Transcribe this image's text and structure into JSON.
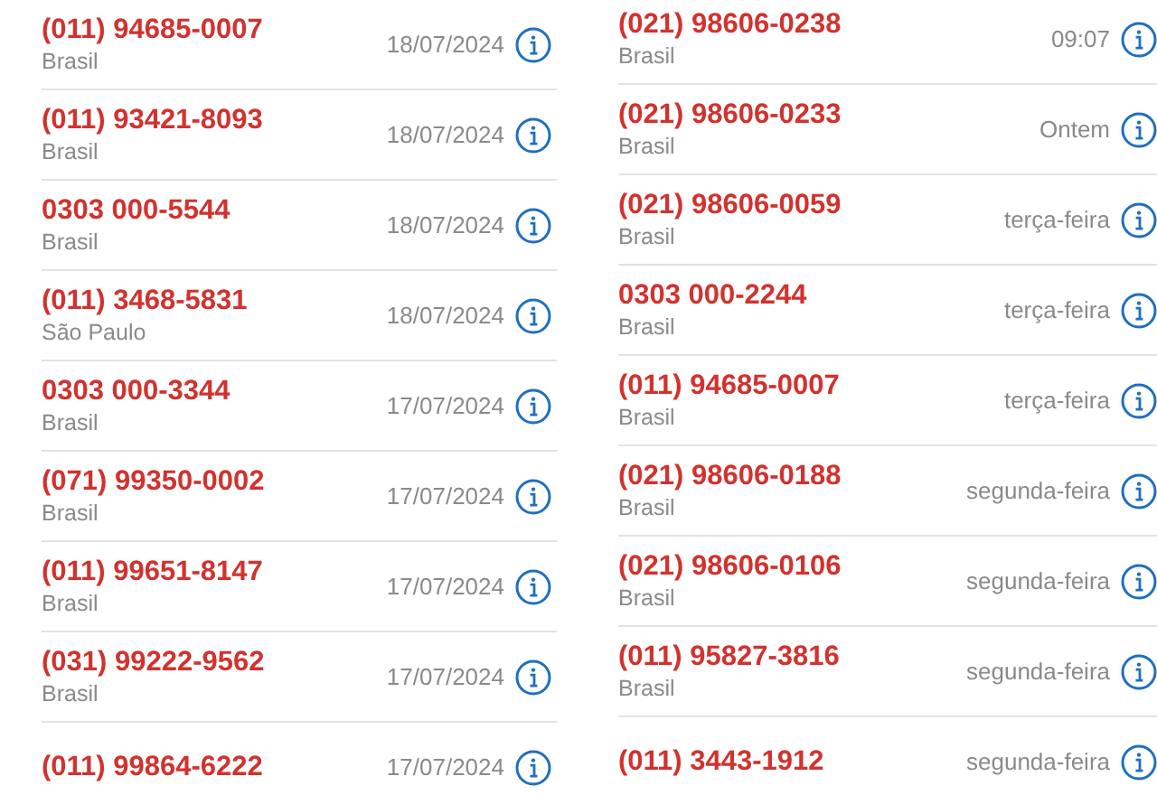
{
  "columns": [
    {
      "calls": [
        {
          "number": "(011) 94685-0007",
          "location": "Brasil",
          "time": "18/07/2024"
        },
        {
          "number": "(011) 93421-8093",
          "location": "Brasil",
          "time": "18/07/2024"
        },
        {
          "number": "0303 000-5544",
          "location": "Brasil",
          "time": "18/07/2024"
        },
        {
          "number": "(011) 3468-5831",
          "location": "São Paulo",
          "time": "18/07/2024"
        },
        {
          "number": "0303 000-3344",
          "location": "Brasil",
          "time": "17/07/2024"
        },
        {
          "number": "(071) 99350-0002",
          "location": "Brasil",
          "time": "17/07/2024"
        },
        {
          "number": "(011) 99651-8147",
          "location": "Brasil",
          "time": "17/07/2024"
        },
        {
          "number": "(031) 99222-9562",
          "location": "Brasil",
          "time": "17/07/2024"
        },
        {
          "number": "(011) 99864-6222",
          "time": "17/07/2024"
        }
      ]
    },
    {
      "calls": [
        {
          "number": "(021) 98606-0238",
          "location": "Brasil",
          "time": "09:07"
        },
        {
          "number": "(021) 98606-0233",
          "location": "Brasil",
          "time": "Ontem"
        },
        {
          "number": "(021) 98606-0059",
          "location": "Brasil",
          "time": "terça-feira"
        },
        {
          "number": "0303 000-2244",
          "location": "Brasil",
          "time": "terça-feira"
        },
        {
          "number": "(011) 94685-0007",
          "location": "Brasil",
          "time": "terça-feira"
        },
        {
          "number": "(021) 98606-0188",
          "location": "Brasil",
          "time": "segunda-feira"
        },
        {
          "number": "(021) 98606-0106",
          "location": "Brasil",
          "time": "segunda-feira"
        },
        {
          "number": "(011) 95827-3816",
          "location": "Brasil",
          "time": "segunda-feira"
        },
        {
          "number": "(011) 3443-1912",
          "time": "segunda-feira"
        }
      ]
    }
  ]
}
